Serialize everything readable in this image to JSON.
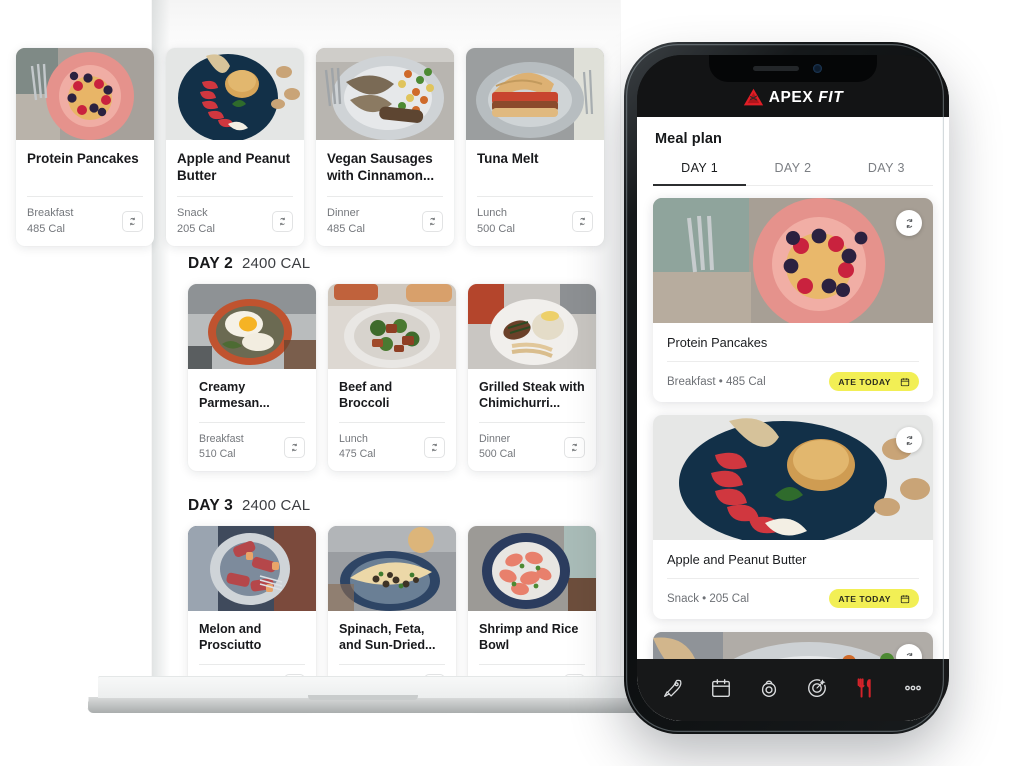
{
  "desktop": {
    "top_row_cards": [
      {
        "title": "Protein Pancakes",
        "type": "Breakfast",
        "calories": "485 Cal",
        "swap_icon": "swap-vertical-icon"
      },
      {
        "title": "Apple and Peanut Butter",
        "type": "Snack",
        "calories": "205 Cal",
        "swap_icon": "swap-vertical-icon"
      },
      {
        "title": "Vegan Sausages with Cinnamon...",
        "type": "Dinner",
        "calories": "485 Cal",
        "swap_icon": "swap-vertical-icon"
      },
      {
        "title": "Tuna Melt",
        "type": "Lunch",
        "calories": "500 Cal",
        "swap_icon": "swap-vertical-icon"
      }
    ],
    "days": [
      {
        "day_label": "DAY 2",
        "day_calories": "2400 CAL",
        "cards": [
          {
            "title": "Creamy Parmesan...",
            "type": "Breakfast",
            "calories": "510 Cal",
            "swap_icon": "swap-vertical-icon"
          },
          {
            "title": "Beef and Broccoli",
            "type": "Lunch",
            "calories": "475 Cal",
            "swap_icon": "swap-vertical-icon"
          },
          {
            "title": "Grilled Steak with Chimichurri...",
            "type": "Dinner",
            "calories": "500 Cal",
            "swap_icon": "swap-vertical-icon"
          }
        ]
      },
      {
        "day_label": "DAY 3",
        "day_calories": "2400 CAL",
        "cards": [
          {
            "title": "Melon and Prosciutto",
            "type": "",
            "calories": "",
            "swap_icon": "swap-vertical-icon"
          },
          {
            "title": "Spinach, Feta, and Sun-Dried...",
            "type": "",
            "calories": "",
            "swap_icon": "swap-vertical-icon"
          },
          {
            "title": "Shrimp and Rice Bowl",
            "type": "",
            "calories": "",
            "swap_icon": "swap-vertical-icon"
          }
        ]
      }
    ]
  },
  "phone": {
    "logo": {
      "text_bold": "APEX",
      "text_italic": "FIT",
      "mark": "apex-triangle-logo",
      "accent": "#e01e26"
    },
    "page_title": "Meal plan",
    "tabs": [
      {
        "label": "DAY 1",
        "active": true
      },
      {
        "label": "DAY 2",
        "active": false
      },
      {
        "label": "DAY 3",
        "active": false
      }
    ],
    "cards": [
      {
        "title": "Protein Pancakes",
        "meta": "Breakfast • 485 Cal",
        "badge": "ATE TODAY",
        "badge_icon": "calendar-icon",
        "swap_icon": "swap-vertical-icon"
      },
      {
        "title": "Apple and Peanut Butter",
        "meta": "Snack • 205 Cal",
        "badge": "ATE TODAY",
        "badge_icon": "calendar-icon",
        "swap_icon": "swap-vertical-icon"
      },
      {
        "title": "",
        "meta": "",
        "badge": "",
        "badge_icon": "calendar-icon",
        "swap_icon": "swap-vertical-icon"
      }
    ],
    "badge_color": "#f2ef55",
    "tabbar": [
      {
        "icon": "rocket-icon",
        "active": false
      },
      {
        "icon": "calendar-icon",
        "active": false
      },
      {
        "icon": "kettlebell-icon",
        "active": false
      },
      {
        "icon": "target-star-icon",
        "active": false
      },
      {
        "icon": "fork-knife-icon",
        "active": true
      },
      {
        "icon": "more-dots-icon",
        "active": false
      }
    ],
    "tabbar_active_color": "#d4232a"
  }
}
